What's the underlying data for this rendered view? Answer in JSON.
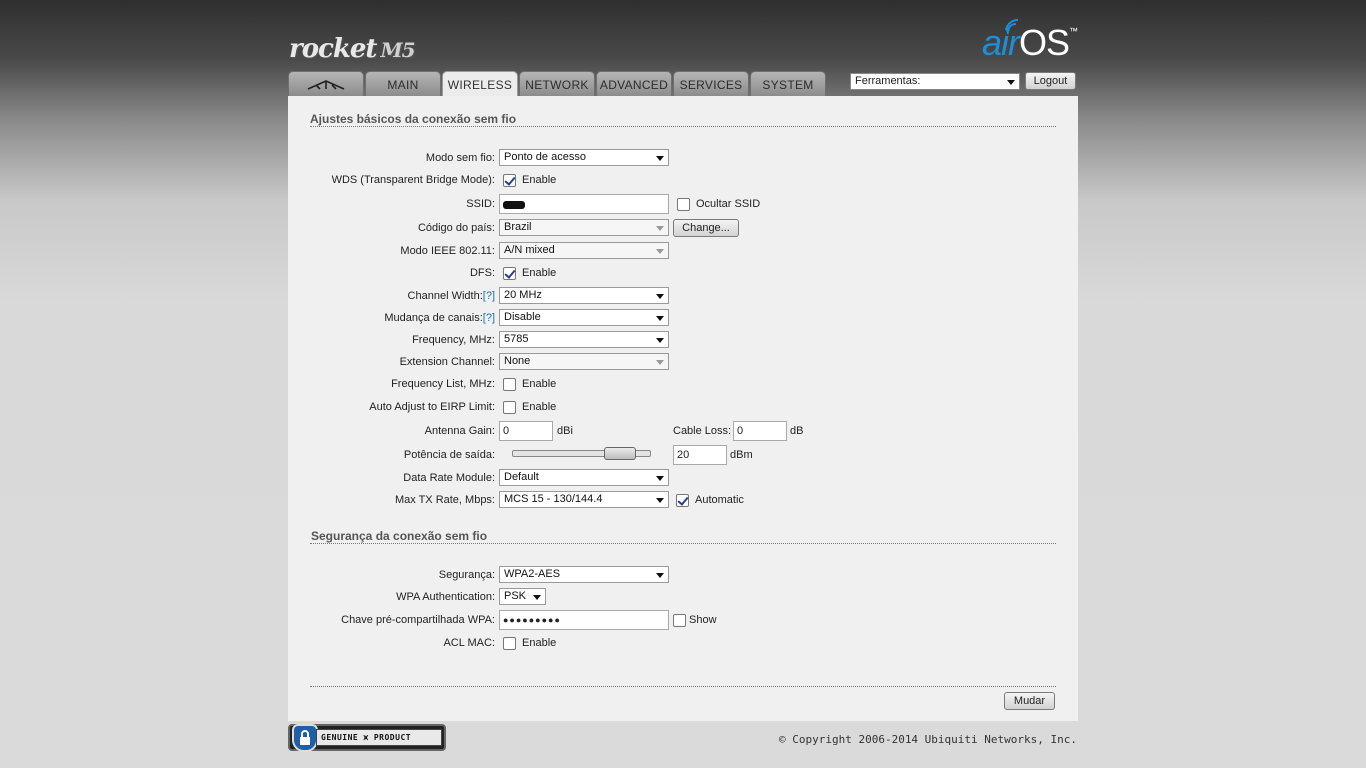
{
  "branding": {
    "product": "rocket",
    "model": "M5",
    "os_air": "air",
    "os_name": "OS",
    "os_tm": "™"
  },
  "tabs": [
    {
      "label": "",
      "icon": "ubiquiti-logo-icon"
    },
    {
      "label": "MAIN"
    },
    {
      "label": "WIRELESS",
      "active": true
    },
    {
      "label": "NETWORK"
    },
    {
      "label": "ADVANCED"
    },
    {
      "label": "SERVICES"
    },
    {
      "label": "SYSTEM"
    }
  ],
  "toolbar": {
    "tools_value": "Ferramentas:",
    "logout_label": "Logout"
  },
  "basic": {
    "title": "Ajustes básicos da conexão sem fio",
    "mode_label": "Modo sem fio:",
    "mode_value": "Ponto de acesso",
    "wds_label": "WDS (Transparent Bridge Mode):",
    "wds_enable": "Enable",
    "ssid_label": "SSID:",
    "hide_ssid_label": "Ocultar SSID",
    "country_label": "Código do país:",
    "country_value": "Brazil",
    "change_label": "Change...",
    "ieee_label": "Modo IEEE 802.11:",
    "ieee_value": "A/N mixed",
    "dfs_label": "DFS:",
    "dfs_enable": "Enable",
    "width_label": "Channel Width:",
    "width_help": "[?]",
    "width_value": "20 MHz",
    "shift_label": "Mudança de canais:",
    "shift_help": "[?]",
    "shift_value": "Disable",
    "freq_label": "Frequency, MHz:",
    "freq_value": "5785",
    "ext_label": "Extension Channel:",
    "ext_value": "None",
    "freqlist_label": "Frequency List, MHz:",
    "freqlist_enable": "Enable",
    "eirp_label": "Auto Adjust to EIRP Limit:",
    "eirp_enable": "Enable",
    "gain_label": "Antenna Gain:",
    "gain_value": "0",
    "gain_unit": "dBi",
    "cable_label": "Cable Loss:",
    "cable_value": "0",
    "cable_unit": "dB",
    "power_label": "Potência de saída:",
    "power_value": "20",
    "power_unit": "dBm",
    "rate_module_label": "Data Rate Module:",
    "rate_module_value": "Default",
    "maxtx_label": "Max TX Rate, Mbps:",
    "maxtx_value": "MCS 15 - 130/144.4",
    "auto_label": "Automatic"
  },
  "security": {
    "title": "Segurança da conexão sem fio",
    "sec_label": "Segurança:",
    "sec_value": "WPA2-AES",
    "auth_label": "WPA Authentication:",
    "auth_value": "PSK",
    "key_label": "Chave pré-compartilhada WPA:",
    "key_value": "●●●●●●●●●",
    "show_label": "Show",
    "acl_label": "ACL MAC:",
    "acl_enable": "Enable"
  },
  "actions": {
    "apply_label": "Mudar"
  },
  "footer": {
    "badge_text": "GENUINE ⩙ PRODUCT",
    "copyright": "© Copyright 2006-2014 Ubiquiti Networks, Inc."
  }
}
